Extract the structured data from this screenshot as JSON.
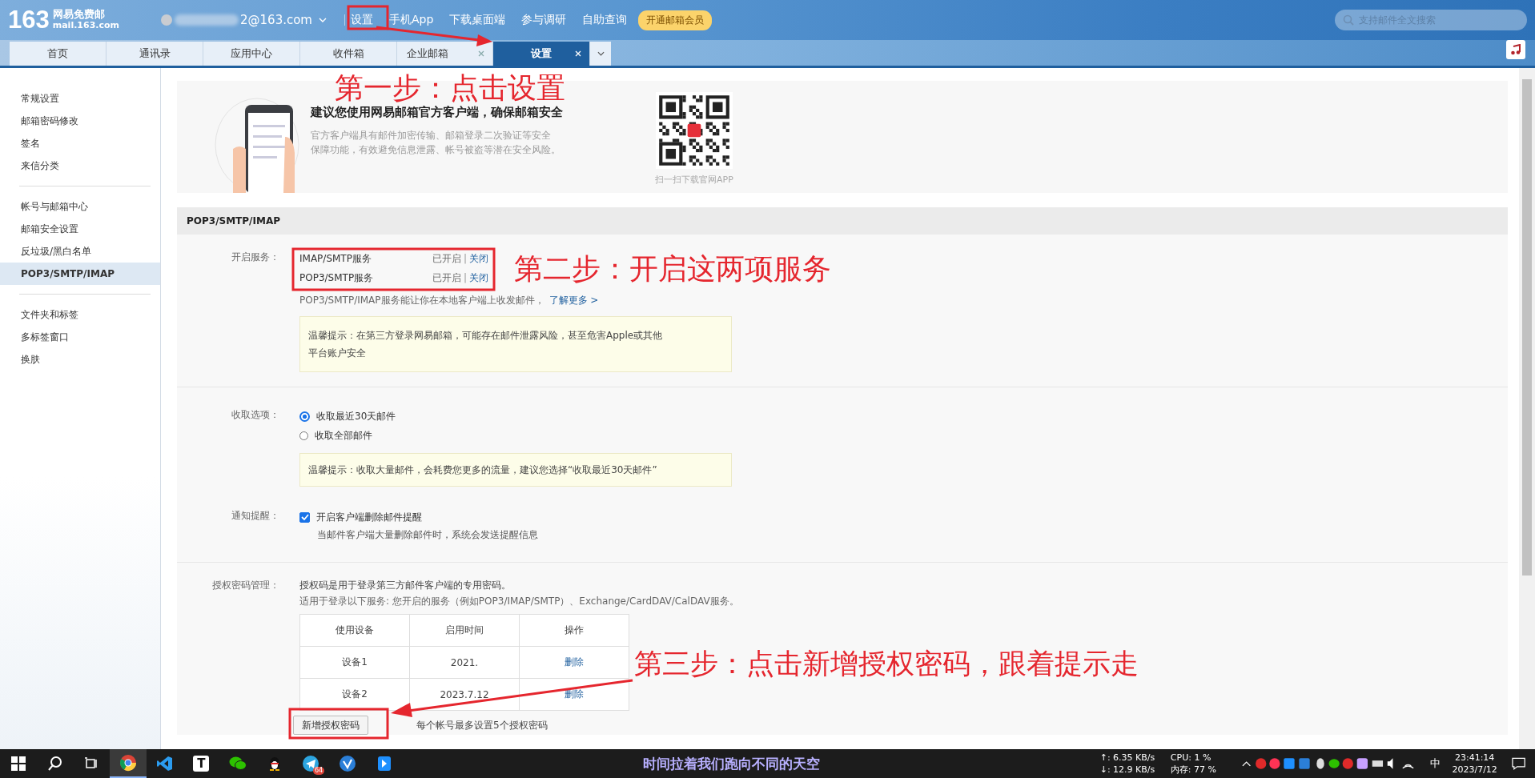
{
  "header": {
    "logo_number": "163",
    "logo_name": "网易免费邮",
    "logo_domain": "mail.163.com",
    "account": "2@163.com",
    "nav": [
      {
        "label": "设置"
      },
      {
        "label": "手机App"
      },
      {
        "label": "下载桌面端"
      },
      {
        "label": "参与调研"
      },
      {
        "label": "自助查询"
      }
    ],
    "vip_button": "开通邮箱会员",
    "search": {
      "placeholder": "支持邮件全文搜索"
    }
  },
  "tabs": [
    {
      "label": "首页",
      "selected": false,
      "closable": false
    },
    {
      "label": "通讯录",
      "selected": false,
      "closable": false
    },
    {
      "label": "应用中心",
      "selected": false,
      "closable": false
    },
    {
      "label": "收件箱",
      "selected": false,
      "closable": false
    },
    {
      "label": "企业邮箱",
      "selected": false,
      "closable": true
    },
    {
      "label": "设置",
      "selected": true,
      "closable": true
    }
  ],
  "sidebar": {
    "groups": [
      [
        {
          "label": "常规设置",
          "selected": false
        },
        {
          "label": "邮箱密码修改",
          "selected": false
        },
        {
          "label": "签名",
          "selected": false
        },
        {
          "label": "来信分类",
          "selected": false
        }
      ],
      [
        {
          "label": "帐号与邮箱中心",
          "selected": false
        },
        {
          "label": "邮箱安全设置",
          "selected": false
        },
        {
          "label": "反垃圾/黑白名单",
          "selected": false
        },
        {
          "label": "POP3/SMTP/IMAP",
          "selected": true
        }
      ],
      [
        {
          "label": "文件夹和标签",
          "selected": false
        },
        {
          "label": "多标签窗口",
          "selected": false
        },
        {
          "label": "换肤",
          "selected": false
        }
      ]
    ]
  },
  "banner": {
    "title": "建议您使用网易邮箱官方客户端，确保邮箱安全",
    "description": [
      "官方客户端具有邮件加密传输、邮箱登录二次验证等安全",
      "保障功能，有效避免信息泄露、帐号被盗等潜在安全风险。"
    ],
    "qr_caption": "扫一扫下载官网APP"
  },
  "section_title": "POP3/SMTP/IMAP",
  "services": {
    "label": "开启服务：",
    "items": [
      {
        "name": "IMAP/SMTP服务",
        "status": "已开启",
        "separator": "|",
        "action": "关闭"
      },
      {
        "name": "POP3/SMTP服务",
        "status": "已开启",
        "separator": "|",
        "action": "关闭"
      }
    ],
    "note": "POP3/SMTP/IMAP服务能让你在本地客户端上收发邮件，",
    "note_link": "了解更多 >",
    "tip": [
      "温馨提示：在第三方登录网易邮箱，可能存在邮件泄露风险，甚至危害Apple或其他",
      "平台账户安全"
    ]
  },
  "receive": {
    "label": "收取选项：",
    "options": [
      {
        "label": "收取最近30天邮件",
        "selected": true
      },
      {
        "label": "收取全部邮件",
        "selected": false
      }
    ],
    "tip": "温馨提示：收取大量邮件，会耗费您更多的流量，建议您选择“收取最近30天邮件”"
  },
  "notify": {
    "label": "通知提醒：",
    "checkbox": {
      "label": "开启客户端删除邮件提醒",
      "checked": true
    },
    "note": "当邮件客户端大量删除邮件时，系统会发送提醒信息"
  },
  "auth": {
    "label": "授权密码管理：",
    "lines": [
      "授权码是用于登录第三方邮件客户端的专用密码。",
      "适用于登录以下服务: 您开启的服务（例如POP3/IMAP/SMTP）、Exchange/CardDAV/CalDAV服务。"
    ],
    "table": {
      "columns": [
        "使用设备",
        "启用时间",
        "操作"
      ],
      "rows": [
        [
          "设备1",
          "2021.",
          "删除"
        ],
        [
          "设备2",
          "2023.7.12",
          "删除"
        ]
      ]
    },
    "button": "新增授权密码",
    "limit_note": "每个帐号最多设置5个授权密码"
  },
  "annotations": [
    "第一步：点击设置",
    "第二步：开启这两项服务",
    "第三步：点击新增授权密码，跟着提示走"
  ],
  "taskbar": {
    "apps": [
      {
        "kind": "start",
        "selected": false
      },
      {
        "kind": "search",
        "selected": false
      },
      {
        "kind": "taskview",
        "selected": false
      },
      {
        "kind": "browser",
        "selected": true
      },
      {
        "kind": "code",
        "selected": false
      },
      {
        "kind": "letter",
        "selected": false,
        "letter": "T"
      },
      {
        "kind": "chat",
        "selected": false
      },
      {
        "kind": "penguin",
        "selected": false
      },
      {
        "kind": "plane",
        "selected": false,
        "badge": "64"
      },
      {
        "kind": "check",
        "selected": false
      },
      {
        "kind": "bookmark",
        "selected": false
      }
    ],
    "lyrics": "时间拉着我们跑向不同的天空",
    "net_up": "↑: 6.35 KB/s",
    "net_down": "↓: 12.9 KB/s",
    "cpu": "CPU: 1 %",
    "memory": "内存: 77 %",
    "ime": "中",
    "time": "23:41:14",
    "date": "2023/7/12"
  }
}
